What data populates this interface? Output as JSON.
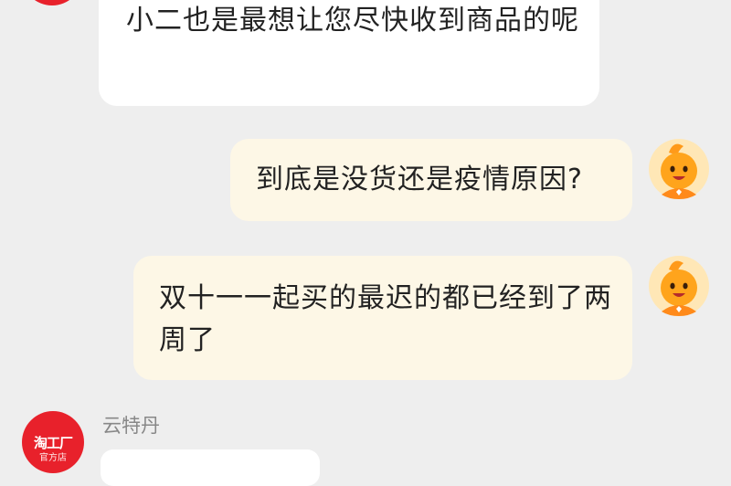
{
  "conversation": {
    "messages": [
      {
        "side": "left",
        "sender": "shop",
        "text": "小二也是最想让您尽快收到商品的呢"
      },
      {
        "side": "right",
        "sender": "user",
        "text": "到底是没货还是疫情原因?"
      },
      {
        "side": "right",
        "sender": "user",
        "text": "双十一一起买的最迟的都已经到了两周了"
      }
    ],
    "next_sender": {
      "name": "云特丹",
      "avatar_logo_text": "淘工厂",
      "avatar_logo_subtext": "官方店"
    }
  },
  "colors": {
    "background": "#eeeeee",
    "incoming_bubble": "#ffffff",
    "outgoing_bubble": "#fdf7e6",
    "shop_brand_red": "#e8212b",
    "user_avatar_orange": "#ffa41c"
  },
  "icons": {
    "user_avatar": "orange-mascot-icon",
    "shop_avatar": "taogongchang-logo-icon"
  }
}
